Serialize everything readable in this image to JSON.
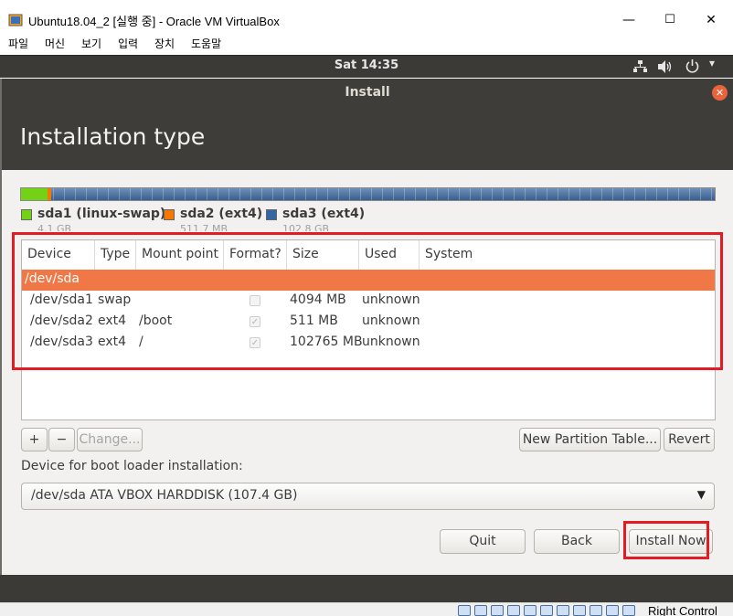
{
  "host_window": {
    "title": "Ubuntu18.04_2 [실행 중] - Oracle VM VirtualBox",
    "menu": [
      "파일",
      "머신",
      "보기",
      "입력",
      "장치",
      "도움말"
    ],
    "controls": {
      "minimize": "—",
      "maximize": "☐",
      "close": "✕"
    }
  },
  "top_panel": {
    "clock": "Sat 14:35"
  },
  "installer": {
    "window_title": "Install",
    "page_title": "Installation type",
    "disk_bar": {
      "segments": [
        {
          "name": "sda1",
          "fraction": 0.038,
          "color": "#73d216"
        },
        {
          "name": "sda2",
          "fraction": 0.005,
          "color": "#f57900"
        },
        {
          "name": "sda3",
          "fraction": 0.957,
          "color": "#3465a4"
        }
      ]
    },
    "legend": [
      {
        "name": "sda1 (linux-swap)",
        "size": "4.1 GB",
        "color": "#73d216"
      },
      {
        "name": "sda2 (ext4)",
        "size": "511.7 MB",
        "color": "#f57900"
      },
      {
        "name": "sda3 (ext4)",
        "size": "102.8 GB",
        "color": "#3465a4"
      }
    ],
    "table": {
      "columns": [
        "Device",
        "Type",
        "Mount point",
        "Format?",
        "Size",
        "Used",
        "System"
      ],
      "selected_row": "/dev/sda",
      "rows": [
        {
          "device": "/dev/sda1",
          "type": "swap",
          "mount": "",
          "format": false,
          "size": "4094 MB",
          "used": "unknown",
          "system": ""
        },
        {
          "device": "/dev/sda2",
          "type": "ext4",
          "mount": "/boot",
          "format": true,
          "size": "511 MB",
          "used": "unknown",
          "system": ""
        },
        {
          "device": "/dev/sda3",
          "type": "ext4",
          "mount": "/",
          "format": true,
          "size": "102765 MB",
          "used": "unknown",
          "system": ""
        }
      ]
    },
    "buttons": {
      "add": "+",
      "remove": "−",
      "change": "Change...",
      "new_table": "New Partition Table...",
      "revert": "Revert",
      "quit": "Quit",
      "back": "Back",
      "install": "Install Now"
    },
    "boot_loader": {
      "label": "Device for boot loader installation:",
      "value": "/dev/sda    ATA VBOX HARDDISK (107.4 GB)"
    }
  },
  "status_bar": {
    "host_key": "Right Control"
  },
  "colors": {
    "selection": "#f07746",
    "highlight_box": "#e31b23"
  }
}
